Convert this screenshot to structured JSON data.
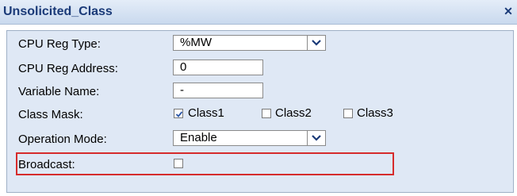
{
  "title": "Unsolicited_Class",
  "close_icon": "close-icon",
  "fields": {
    "cpu_reg_type": {
      "label": "CPU Reg Type:",
      "value": "%MW"
    },
    "cpu_reg_address": {
      "label": "CPU Reg Address:",
      "value": "0"
    },
    "variable_name": {
      "label": "Variable Name:",
      "value": "-"
    },
    "class_mask": {
      "label": "Class Mask:",
      "options": [
        {
          "label": "Class1",
          "checked": true
        },
        {
          "label": "Class2",
          "checked": false
        },
        {
          "label": "Class3",
          "checked": false
        }
      ]
    },
    "operation_mode": {
      "label": "Operation Mode:",
      "value": "Enable"
    },
    "broadcast": {
      "label": "Broadcast:",
      "checked": false
    }
  },
  "colors": {
    "title_text": "#1a3a78",
    "panel_bg": "#dfe8f5",
    "highlight_border": "#d62b2b"
  }
}
